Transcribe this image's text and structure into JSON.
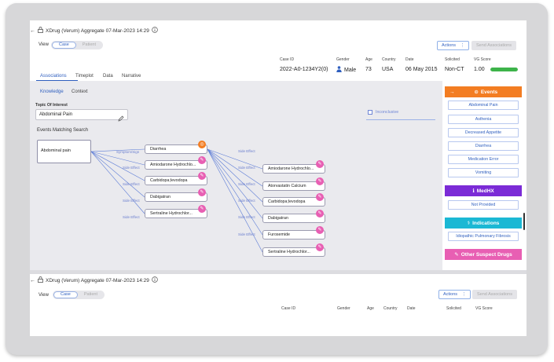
{
  "colors": {
    "accent": "#2f5fbf",
    "events": "#f37d22",
    "medhx": "#7b2bd6",
    "indications": "#1bb8d4",
    "suspect": "#e85fb3",
    "vg_bar": "#3db34a"
  },
  "header": {
    "title": "XDrug (Verum) Aggregate 07-Mar-2023 14:29",
    "view_label": "View",
    "toggle": [
      "Case",
      "Patient"
    ],
    "actions_label": "Actions",
    "send_label": "Send Associations"
  },
  "case_info": {
    "labels": [
      "Case ID",
      "Gender",
      "Age",
      "Country",
      "Date",
      "Solicited",
      "VG Score"
    ],
    "values": {
      "case_id": "2022-A0-1234Y2(0)",
      "gender": "Male",
      "age": "73",
      "country": "USA",
      "date": "06 May 2015",
      "solicited": "Non-CT",
      "vg_score": "1.00",
      "vg_fill": 1.0
    }
  },
  "tabs": [
    "Associations",
    "Timeplot",
    "Data",
    "Narrative"
  ],
  "subtabs": [
    "Knowledge",
    "Context"
  ],
  "topic": {
    "label": "Topic Of Interest",
    "value": "Abdominal Pain"
  },
  "inconclusive_label": "Inconclusive",
  "events_matching_title": "Events Matching Search",
  "graph": {
    "root": "Abdominal pain",
    "symptom_label": "Symptom/Sign",
    "side_effect_label": "Side Effect",
    "level1": [
      "Diarrhea",
      "Amiodarone Hydrochlo...",
      "Carbidopa;levodopa",
      "Dabigatran",
      "Sertraline Hydrochlor..."
    ],
    "level2": [
      "Amiodarone Hydrochlo...",
      "Atorvastatin Calcium",
      "Carbidopa;levodopa",
      "Dabigatran",
      "Furosemide",
      "Sertraline Hydrochlor..."
    ]
  },
  "panel": {
    "events_title": "Events",
    "events": [
      "Abdominal Pain",
      "Asthenia",
      "Decreased Appetite",
      "Diarrhea",
      "Medication Error",
      "Vomiting"
    ],
    "medhx_title": "MedHX",
    "medhx": [
      "Not Provided"
    ],
    "indications_title": "Indications",
    "indications": [
      "Idiopathic Pulmonary Fibrosis"
    ],
    "suspect_title": "Other Suspect Drugs"
  },
  "second": {
    "title": "XDrug (Verum) Aggregate 07-Mar-2023 14:29",
    "view_label": "View",
    "toggle": [
      "Case",
      "Patient"
    ],
    "actions_label": "Actions",
    "send_label": "Send Associations",
    "labels": [
      "Case ID",
      "Gender",
      "Age",
      "Country",
      "Date",
      "Solicited",
      "VG Score"
    ]
  }
}
